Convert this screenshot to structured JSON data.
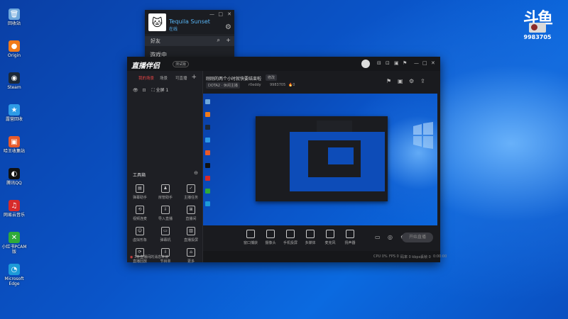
{
  "desktop": {
    "icons": [
      {
        "label": "回收站",
        "glyph": "🗑",
        "color": "#6fa8dc"
      },
      {
        "label": "Origin",
        "glyph": "●",
        "color": "#f07a1a"
      },
      {
        "label": "Steam",
        "glyph": "◉",
        "color": "#1b2838"
      },
      {
        "label": "露营回收",
        "glyph": "★",
        "color": "#2e9be6"
      },
      {
        "label": "哈王收集站",
        "glyph": "▣",
        "color": "#e85a2a"
      },
      {
        "label": "腾讯QQ",
        "glyph": "◐",
        "color": "#111111"
      },
      {
        "label": "网易云音乐",
        "glyph": "♫",
        "color": "#d72a2a"
      },
      {
        "label": "小红书PCAM版",
        "glyph": "✕",
        "color": "#2faa3a"
      },
      {
        "label": "Microsoft Edge",
        "glyph": "◔",
        "color": "#1d9bd8"
      }
    ]
  },
  "overlay": {
    "logo": "斗鱼",
    "room_number": "9983705"
  },
  "friends_window": {
    "user_name": "Tequila Sunset",
    "status": "在线",
    "tab": "好友",
    "section": "游戏中",
    "controls": [
      "—",
      "□",
      "✕"
    ]
  },
  "app": {
    "brand": "直播伴侣",
    "version": "测试版",
    "titlebar_icons": [
      "⊟",
      "⊡",
      "▣",
      "⚑",
      "—",
      "□",
      "✕"
    ],
    "tabs": [
      "我的场景",
      "场景",
      "可直播"
    ],
    "tab_add": "+",
    "scene_row": "全屏 1",
    "tools_header": "工具箱",
    "tools": [
      {
        "label": "弹幕助手",
        "icon": "▤"
      },
      {
        "label": "房管助手",
        "icon": "♟"
      },
      {
        "label": "主播任务",
        "icon": "✓"
      },
      {
        "label": "视频连麦",
        "icon": "⟲"
      },
      {
        "label": "导入直播",
        "icon": "⇩"
      },
      {
        "label": "直播间",
        "icon": "⊞"
      },
      {
        "label": "虚拟形象",
        "icon": "☺"
      },
      {
        "label": "弹幕机",
        "icon": "▭"
      },
      {
        "label": "直播投屏",
        "icon": "▥"
      },
      {
        "label": "直播回放",
        "icon": "⟳"
      },
      {
        "label": "节目单",
        "icon": "⇩"
      },
      {
        "label": "更多",
        "icon": "⌂"
      }
    ],
    "notice": "3条直播间的消息未读",
    "room_title": "刚刚的两个小时就快要结束啦",
    "modify": "修改",
    "category": "DOTA2 · 休闲主播",
    "streamer_name": "r0eddy",
    "room_id": "9983705",
    "hot": "0",
    "header_icons": [
      "⚑",
      "▣",
      "⚙",
      "⇪"
    ],
    "bottom_controls": [
      {
        "label": "窗口捕获"
      },
      {
        "label": "摄像头"
      },
      {
        "label": "手机投屏"
      },
      {
        "label": "多媒体"
      },
      {
        "label": "麦克风"
      },
      {
        "label": "扬声器"
      }
    ],
    "live_button": "开始直播",
    "status_items": [
      "CPU 0%",
      "FPS 0",
      "码率 0 kbps",
      "丢帧 0",
      "0:00:00"
    ]
  },
  "colors": {
    "accent_red": "#e64545",
    "steam_blue": "#57b4f4",
    "desktop_blue": "#0a54c8"
  }
}
